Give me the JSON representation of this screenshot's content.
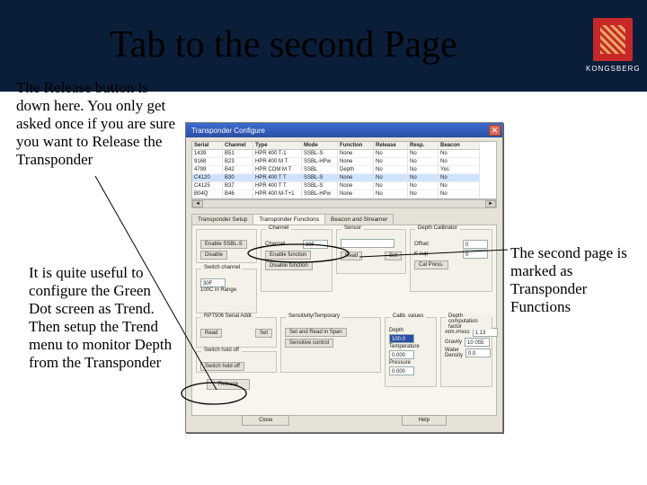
{
  "brand": {
    "name": "KONGSBERG"
  },
  "slide_title": "Tab to the second Page",
  "notes": {
    "release": "The Release button is down here. You only get asked once if you are sure you want to Release the Transponder",
    "green_dot": "It is quite useful to configure the Green Dot screen as Trend. Then setup the Trend menu to monitor Depth from the Transponder",
    "second_page": "The second page is marked as Transponder Functions"
  },
  "dialog": {
    "title": "Transponder Configure",
    "grid_headers": [
      "Serial",
      "Channel",
      "Type",
      "Mode",
      "Function",
      "Release",
      "Resp.",
      "Beacon"
    ],
    "rows": [
      [
        "1439",
        "B51",
        "HPR 400 T-1",
        "SSBL-S",
        "None",
        "No",
        "No",
        "No"
      ],
      [
        "9168",
        "B23",
        "HPR 400 M T",
        "SSBL-HPw",
        "None",
        "No",
        "No",
        "No"
      ],
      [
        "4799",
        "B42",
        "HPR COM M T",
        "SSBL",
        "Depth",
        "No",
        "No",
        "Yes"
      ],
      [
        "C4120",
        "B30",
        "HPR 400 T T",
        "SSBL-S",
        "None",
        "No",
        "No",
        "No"
      ],
      [
        "C4125",
        "B37",
        "HPR 400 T T",
        "SSBL-S",
        "None",
        "No",
        "No",
        "No"
      ],
      [
        "B04Q",
        "B46",
        "HPR 400 M-T+1",
        "SSBL-HPw",
        "None",
        "No",
        "No",
        "No"
      ]
    ],
    "tabs": [
      "Transponder Setup",
      "Transponder Functions",
      "Beacon and Streamer"
    ],
    "groups": {
      "enable": {
        "enable_btn": "Enable SSBL-S",
        "disable_btn": "Disable"
      },
      "channel": {
        "legend": "Channel",
        "value": "30F",
        "enable": "Enable function",
        "disable": "Disable function"
      },
      "switch": {
        "legend": "Switch channel",
        "value": "30F",
        "option": "100C in Range"
      },
      "sensor": {
        "legend": "Sensor",
        "read": "Read",
        "set": "Set"
      },
      "depthcal": {
        "legend": "Depth Calibrator",
        "offset_lbl": "Offset",
        "offset": "0",
        "k_lbl": "K sup",
        "k": "0",
        "calib": "Cal Press."
      },
      "rpt": {
        "legend": "RPT506 Serial Addr.",
        "read": "Read",
        "set": "Set"
      },
      "switchhold": {
        "legend": "Switch hold off",
        "label": "Switch hold off"
      },
      "sensitivity": {
        "legend": "Sensitivity/Temporary",
        "btn": "Set and Read in Span",
        "btn2": "Sensitive control"
      },
      "release": {
        "btn": "Release"
      },
      "calval": {
        "legend": "Calib. values",
        "depth_l": "Depth",
        "depth": "100.0",
        "temp_l": "Temperature",
        "temp": "0.000",
        "pres_l": "Pressure",
        "pres": "0.000"
      },
      "depthcomp": {
        "legend": "Depth computation factor",
        "atm_l": "Atm.Press",
        "atm": "1.13",
        "grav_l": "Gravity",
        "grav": "10 055",
        "wd_l": "Water Density",
        "wd": "0.0"
      }
    },
    "bottom": {
      "close": "Close",
      "help": "Help"
    }
  },
  "colors": {
    "header_bg": "#0a1e3a",
    "title_fg": "#000000",
    "crest": "#c62828",
    "win_blue": "#2a4fa5"
  }
}
